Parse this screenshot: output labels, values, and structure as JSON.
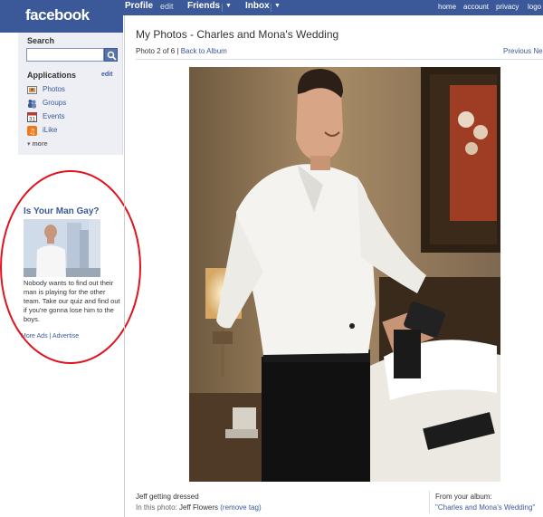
{
  "brand": {
    "logo_text": "facebook",
    "bar_color": "#3b5998"
  },
  "topnav": {
    "profile": "Profile",
    "edit": "edit",
    "friends": "Friends",
    "inbox": "Inbox",
    "right_links": [
      "home",
      "account",
      "privacy",
      "logo"
    ]
  },
  "sidebar": {
    "search_label": "Search",
    "search_value": "",
    "apps_label": "Applications",
    "apps_edit": "edit",
    "apps": [
      {
        "label": "Photos",
        "icon": "photos-icon"
      },
      {
        "label": "Groups",
        "icon": "groups-icon"
      },
      {
        "label": "Events",
        "icon": "events-icon"
      },
      {
        "label": "iLike",
        "icon": "ilike-icon"
      }
    ],
    "more": "▾ more"
  },
  "ad": {
    "title": "Is Your Man Gay?",
    "body": "Nobody wants to find out their man is playing for the other team. Take our quiz and find out if you're gonna lose him to the boys.",
    "more_ads": "More Ads",
    "separator": "|",
    "advertise": "Advertise",
    "highlight_color": "#e0141e"
  },
  "main": {
    "title": "My Photos - Charles and Mona's Wedding",
    "photo_position": "Photo 2 of 6",
    "separator": "|",
    "back_link": "Back to Album",
    "previous": "Previous",
    "next": "Ne",
    "caption": "Jeff getting dressed",
    "in_photo_prefix": "In this photo:",
    "tagged_name": "Jeff Flowers",
    "remove_tag": "(remove tag)",
    "album_label": "From your album:",
    "album_name": "\"Charles and Mona's Wedding\""
  }
}
